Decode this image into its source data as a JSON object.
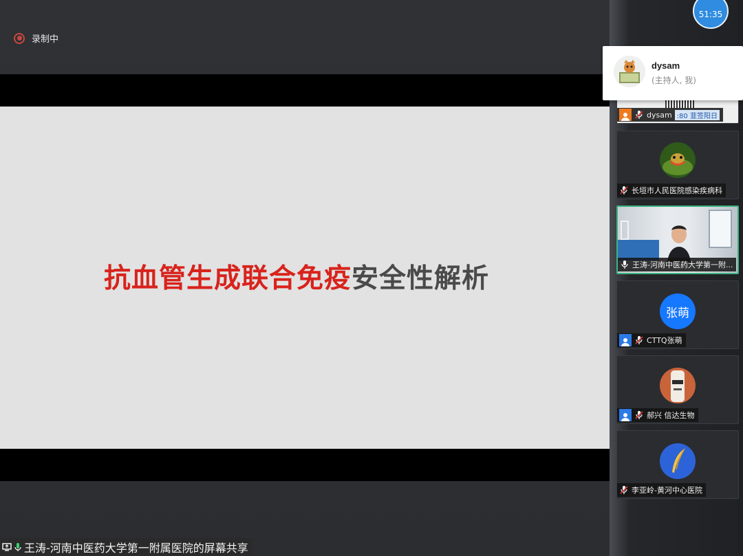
{
  "recording": {
    "label": "录制中"
  },
  "timer": {
    "value": "51:35"
  },
  "slide": {
    "title_red": "抗血管生成联合免疫",
    "title_dark": "安全性解析"
  },
  "share_bar": {
    "text": "王涛-河南中医药大学第一附属医院的屏幕共享"
  },
  "host_card": {
    "name": "dysam",
    "role": "(主持人, 我)"
  },
  "participants": [
    {
      "name": "dysam",
      "overlay_text": ":80  韮签阳日",
      "badge": "orange"
    },
    {
      "name": "长垣市人民医院感染疾病科"
    },
    {
      "name": "王涛-河南中医药大学第一附..."
    },
    {
      "name": "CTTQ张萌",
      "avatar_text": "张萌",
      "badge": "blue"
    },
    {
      "name": "郝兴  信达生物",
      "badge": "blue"
    },
    {
      "name": "李亚岭-黄河中心医院"
    }
  ],
  "colors": {
    "accent_red": "#d8231c",
    "timer_blue": "#2f8ce0",
    "active_border": "#3fb27f"
  }
}
